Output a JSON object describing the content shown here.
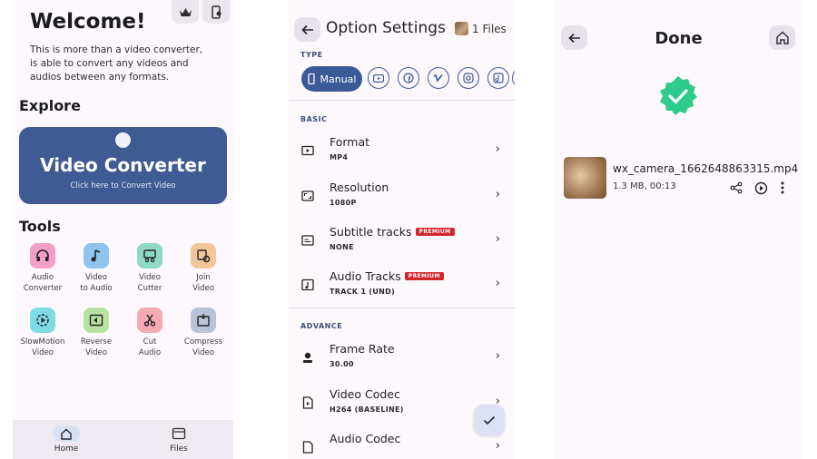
{
  "home": {
    "title": "Welcome!",
    "intro": "This is more than a video converter, is able to convert any videos and audios between any formats.",
    "explore_heading": "Explore",
    "hero": {
      "title": "Video Converter",
      "subtitle": "Click here to Convert Video"
    },
    "tools_heading": "Tools",
    "tools": [
      {
        "label": "Audio\nConverter",
        "icon": "headphones-icon",
        "color": "#f3a0c6"
      },
      {
        "label": "Video\nto Audio",
        "icon": "music-note-icon",
        "color": "#8ec4ee"
      },
      {
        "label": "Video\nCutter",
        "icon": "film-cut-icon",
        "color": "#8fd8c5"
      },
      {
        "label": "Join\nVideo",
        "icon": "join-video-icon",
        "color": "#f5c59a"
      },
      {
        "label": "SlowMotion\nVideo",
        "icon": "slow-motion-icon",
        "color": "#7fdbe6"
      },
      {
        "label": "Reverse\nVideo",
        "icon": "reverse-icon",
        "color": "#b8e2a0"
      },
      {
        "label": "Cut\nAudio",
        "icon": "scissors-icon",
        "color": "#f5aab1"
      },
      {
        "label": "Compress\nVideo",
        "icon": "compress-icon",
        "color": "#b9c2d8"
      }
    ],
    "nav": [
      {
        "label": "Home",
        "icon": "home-icon",
        "active": true
      },
      {
        "label": "Files",
        "icon": "files-icon",
        "active": false
      }
    ]
  },
  "settings": {
    "title": "Option Settings",
    "files_count": "1 Files",
    "type_heading": "TYPE",
    "type_selected": "Manual",
    "type_chips": [
      "youtube-icon",
      "facebook-icon",
      "vimeo-icon",
      "instagram-icon",
      "tiktok-icon"
    ],
    "basic_heading": "BASIC",
    "basic": [
      {
        "title": "Format",
        "value": "MP4",
        "premium": false,
        "icon": "video-format-icon"
      },
      {
        "title": "Resolution",
        "value": "1080P",
        "premium": false,
        "icon": "resolution-icon"
      },
      {
        "title": "Subtitle tracks",
        "value": "NONE",
        "premium": true,
        "icon": "subtitles-icon"
      },
      {
        "title": "Audio Tracks",
        "value": "TRACK 1 (UND)",
        "premium": true,
        "icon": "audio-track-icon"
      }
    ],
    "premium_label": "PREMIUM",
    "advance_heading": "ADVANCE",
    "advance": [
      {
        "title": "Frame Rate",
        "value": "30.00",
        "icon": "frame-rate-icon"
      },
      {
        "title": "Video Codec",
        "value": "H264 (BASELINE)",
        "icon": "video-codec-icon"
      },
      {
        "title": "Audio Codec",
        "value": "",
        "icon": "audio-codec-icon"
      }
    ]
  },
  "done": {
    "title": "Done",
    "file_name": "wx_camera_1662648863315.mp4",
    "file_meta": "1.3 MB, 00:13",
    "success_color": "#2ecc8a"
  }
}
